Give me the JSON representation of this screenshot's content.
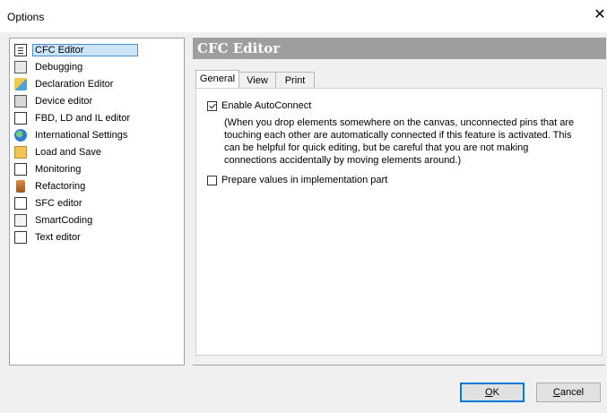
{
  "window": {
    "title": "Options",
    "close_glyph": "✕"
  },
  "tree": {
    "items": [
      {
        "label": "CFC Editor",
        "icon": "cfc-editor-icon",
        "selected": true
      },
      {
        "label": "Debugging",
        "icon": "debugging-icon"
      },
      {
        "label": "Declaration Editor",
        "icon": "declaration-editor-icon"
      },
      {
        "label": "Device editor",
        "icon": "device-editor-icon"
      },
      {
        "label": "FBD, LD and IL editor",
        "icon": "fbd-ld-il-editor-icon"
      },
      {
        "label": "International Settings",
        "icon": "globe-icon"
      },
      {
        "label": "Load and Save",
        "icon": "folder-icon"
      },
      {
        "label": "Monitoring",
        "icon": "monitoring-icon"
      },
      {
        "label": "Refactoring",
        "icon": "refactoring-icon"
      },
      {
        "label": "SFC editor",
        "icon": "sfc-editor-icon"
      },
      {
        "label": "SmartCoding",
        "icon": "smartcoding-icon"
      },
      {
        "label": "Text editor",
        "icon": "text-editor-icon"
      }
    ]
  },
  "header": {
    "title": "CFC Editor"
  },
  "tabs": [
    {
      "label": "General",
      "active": true
    },
    {
      "label": "View"
    },
    {
      "label": "Print"
    }
  ],
  "general": {
    "autoconnect": {
      "label": "Enable AutoConnect",
      "checked": true,
      "description": "(When you drop elements somewhere on the canvas, unconnected pins that are\ntouching each other are automatically connected if this feature is activated. This\ncan be helpful for quick editing, but be careful that you are not making\nconnections accidentally by moving elements around.)"
    },
    "prepare_values": {
      "label": "Prepare values in implementation part",
      "checked": false
    }
  },
  "buttons": {
    "ok": {
      "mnemonic": "O",
      "rest": "K"
    },
    "cancel": {
      "mnemonic": "C",
      "rest": "ancel"
    }
  }
}
